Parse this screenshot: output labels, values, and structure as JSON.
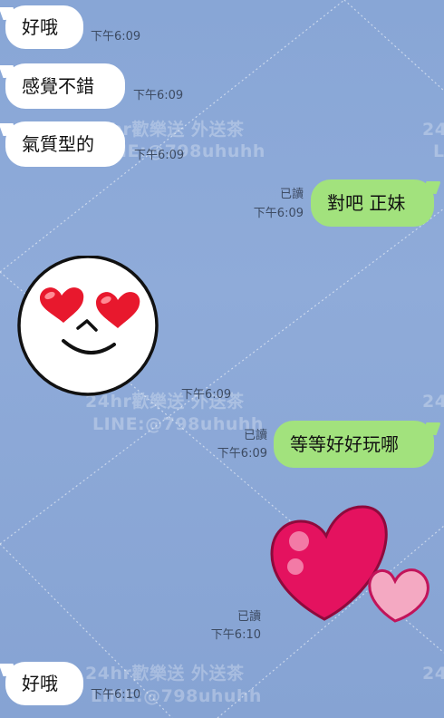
{
  "watermark": {
    "line1": "24hr歡樂送 外送茶",
    "line2": "LINE:@798uhuhh"
  },
  "messages": [
    {
      "side": "in",
      "text": "好哦",
      "time": "下午6:09"
    },
    {
      "side": "in",
      "text": "感覺不錯",
      "time": "下午6:09"
    },
    {
      "side": "in",
      "text": "氣質型的",
      "time": "下午6:09"
    },
    {
      "side": "out",
      "text": "對吧 正妹",
      "read": "已讀",
      "time": "下午6:09"
    },
    {
      "side": "in",
      "sticker": "heart-eyes-face-icon",
      "time": "下午6:09"
    },
    {
      "side": "out",
      "text": "等等好好玩哪",
      "read": "已讀",
      "time": "下午6:09"
    },
    {
      "side": "out",
      "sticker": "pink-hearts-icon",
      "read": "已讀",
      "time": "下午6:10"
    },
    {
      "side": "in",
      "text": "好哦",
      "time": "下午6:10"
    }
  ],
  "colors": {
    "background": "#8aa8d8",
    "incoming_bubble": "#ffffff",
    "outgoing_bubble": "#a2e27d",
    "meta_text": "#3d4b62"
  }
}
